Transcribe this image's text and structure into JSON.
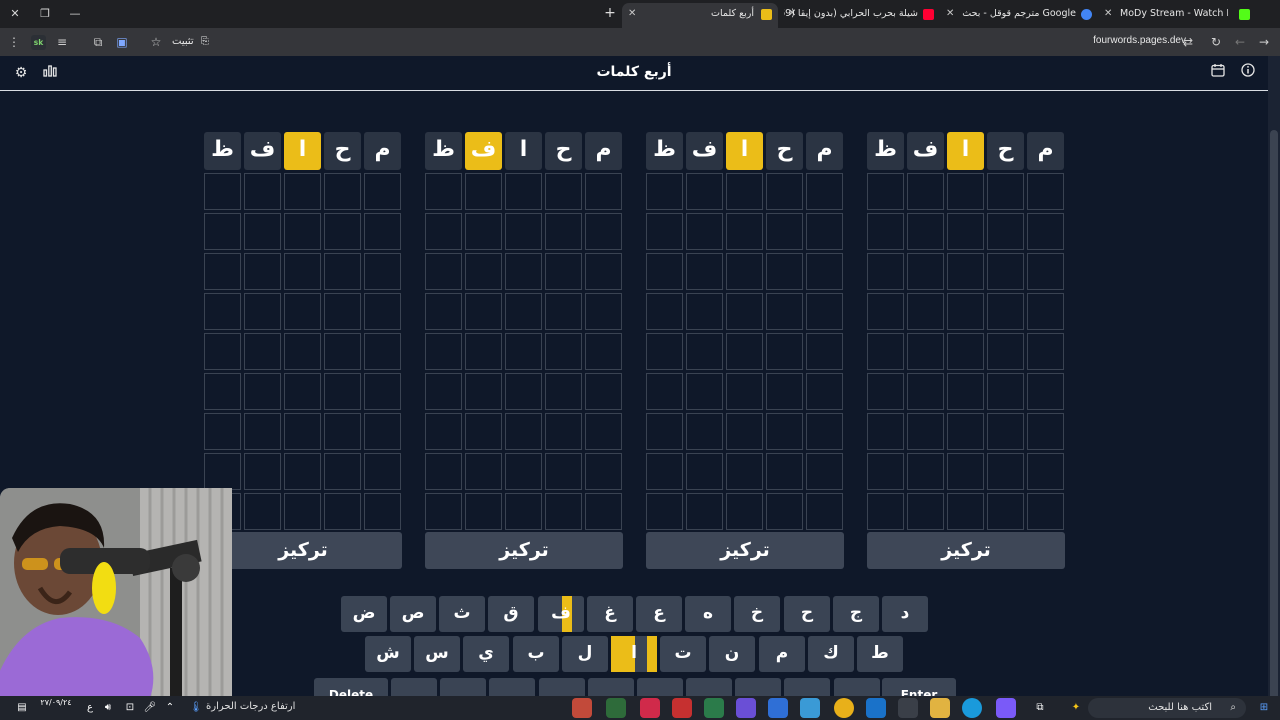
{
  "browser": {
    "tabs": [
      {
        "title": "MoDy Stream - Watch Live on",
        "favicon_color": "#53fc18"
      },
      {
        "title": "مترجم قوقل - بحث Google",
        "favicon_color": "#4285f4"
      },
      {
        "title": "(69) شيلة بحرب الحرابي (بدون إيقا",
        "favicon_color": "#ff0033"
      },
      {
        "title": "أربع كلمات",
        "favicon_color": "#ebbd18"
      }
    ],
    "url": "fourwords.pages.dev",
    "pin_label": "تثبيت",
    "extension_badge": "sk"
  },
  "app": {
    "title": "أربع كلمات"
  },
  "boards": [
    {
      "header": [
        "م",
        "ح",
        "ا",
        "ف",
        "ظ"
      ],
      "highlight_index": 2,
      "focus_label": "تركيز"
    },
    {
      "header": [
        "م",
        "ح",
        "ا",
        "ف",
        "ظ"
      ],
      "highlight_index": 3,
      "focus_label": "تركيز"
    },
    {
      "header": [
        "م",
        "ح",
        "ا",
        "ف",
        "ظ"
      ],
      "highlight_index": 2,
      "focus_label": "تركيز"
    },
    {
      "header": [
        "م",
        "ح",
        "ا",
        "ف",
        "ظ"
      ],
      "highlight_index": 2,
      "focus_label": "تركيز"
    }
  ],
  "keyboard": {
    "row1": [
      "د",
      "ج",
      "ح",
      "خ",
      "ه",
      "ع",
      "غ",
      "ف",
      "ق",
      "ث",
      "ص",
      "ض"
    ],
    "row2": [
      "ط",
      "ك",
      "م",
      "ن",
      "ت",
      "ا",
      "ل",
      "ب",
      "ي",
      "س",
      "ش"
    ],
    "row3_visible": [
      "Enter",
      "Delete"
    ]
  },
  "taskbar": {
    "search_placeholder": "اكتب هنا للبحث",
    "weather_text": "ارتفاع درجات الحرارة",
    "date_text": "٢٧/٠٩/٢٤"
  }
}
